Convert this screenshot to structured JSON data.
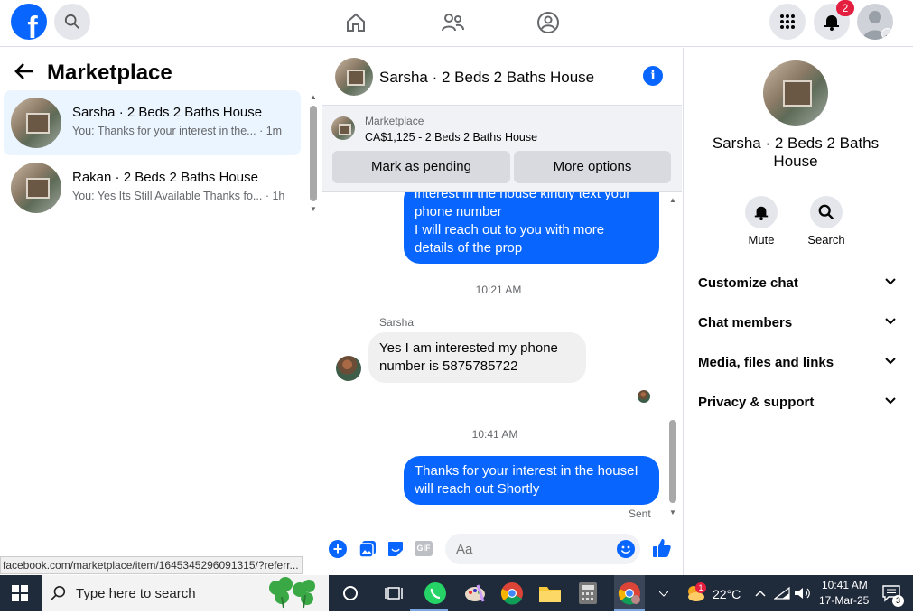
{
  "topbar": {
    "logo_letter": "f",
    "notification_count": "2"
  },
  "left": {
    "title": "Marketplace",
    "conversations": [
      {
        "name": "Sarsha · 2 Beds 2 Baths House",
        "preview": "You: Thanks for your interest in the...",
        "time": "· 1m"
      },
      {
        "name": "Rakan · 2 Beds 2 Baths House",
        "preview": "You: Yes Its Still Available Thanks fo...",
        "time": "· 1h"
      }
    ],
    "status_url": "facebook.com/marketplace/item/1645345296091315/?referr..."
  },
  "chat": {
    "title": "Sarsha · 2 Beds 2 Baths House",
    "marketplace_label": "Marketplace",
    "listing": "CA$1,125 - 2 Beds 2 Baths House",
    "mark_pending": "Mark as pending",
    "more_options": "More options",
    "msg1_lines": [
      "interest in the house kindly  text your",
      "phone number",
      "I will reach out to you with more",
      "details of the prop"
    ],
    "time1": "10:21 AM",
    "sender": "Sarsha",
    "msg2_lines": [
      "Yes I am interested my phone",
      "number is 5875785722"
    ],
    "time2": "10:41 AM",
    "msg3_lines": [
      "Thanks for your interest in the houseI",
      "will reach out Shortly"
    ],
    "sent": "Sent",
    "composer_placeholder": "Aa"
  },
  "right": {
    "title": "Sarsha · 2 Beds 2 Baths House",
    "mute": "Mute",
    "search": "Search",
    "rows": [
      "Customize chat",
      "Chat members",
      "Media, files and links",
      "Privacy & support"
    ]
  },
  "taskbar": {
    "search_text": "Type here to search",
    "temp": "22°C",
    "time": "10:41 AM",
    "date": "17-Mar-25",
    "weather_badge": "1",
    "notif_count": "3"
  },
  "colors": {
    "accent": "#0866ff",
    "taskbar": "#1f2a3a"
  }
}
